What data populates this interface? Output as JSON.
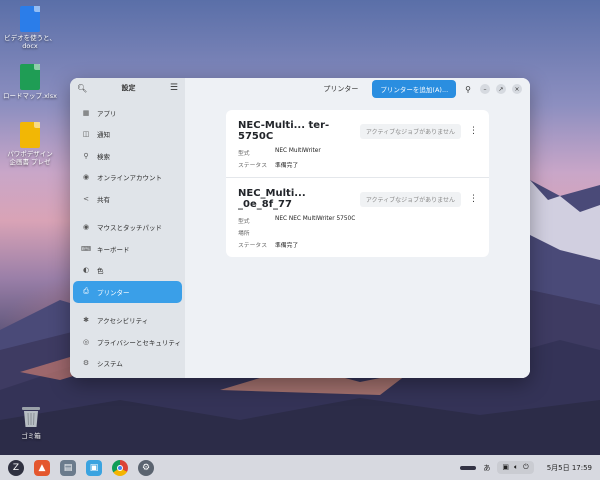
{
  "desktop": {
    "icons": [
      {
        "label": "ビデオを使うと、\ndocx",
        "color": "#2b7de9"
      },
      {
        "label": "ロードマップ.xlsx",
        "color": "#1f9d55"
      },
      {
        "label": "パワポデザイン\n企画書 プレゼ",
        "color": "#f2b705"
      }
    ],
    "trash_label": "ゴミ箱"
  },
  "window": {
    "sidebar_title": "設定",
    "header_title": "プリンター",
    "add_button": "プリンターを追加(A)...",
    "sidebar": {
      "items": [
        {
          "label": "アプリ",
          "icon": "apps-icon"
        },
        {
          "label": "通知",
          "icon": "bell-icon"
        },
        {
          "label": "検索",
          "icon": "search-icon"
        },
        {
          "label": "オンラインアカウント",
          "icon": "account-icon"
        },
        {
          "label": "共有",
          "icon": "share-icon"
        },
        {
          "label": "マウスとタッチパッド",
          "icon": "mouse-icon"
        },
        {
          "label": "キーボード",
          "icon": "keyboard-icon"
        },
        {
          "label": "色",
          "icon": "color-icon"
        },
        {
          "label": "プリンター",
          "icon": "printer-icon"
        },
        {
          "label": "アクセシビリティ",
          "icon": "accessibility-icon"
        },
        {
          "label": "プライバシーとセキュリティ",
          "icon": "privacy-icon"
        },
        {
          "label": "システム",
          "icon": "gear-icon"
        }
      ]
    },
    "printers": [
      {
        "name": "NEC-Multi... ter-5750C",
        "jobs": "アクティブなジョブがありません",
        "rows": [
          {
            "k": "型式",
            "v": "NEC MultiWriter"
          },
          {
            "k": "ステータス",
            "v": "準備完了"
          }
        ]
      },
      {
        "name": "NEC_Multi... _0e_8f_77",
        "jobs": "アクティブなジョブがありません",
        "rows": [
          {
            "k": "型式",
            "v": "NEC NEC MultiWriter 5750C"
          },
          {
            "k": "場所",
            "v": ""
          },
          {
            "k": "ステータス",
            "v": "準備完了"
          }
        ]
      }
    ]
  },
  "taskbar": {
    "input_method": "あ",
    "clock": "5月5日 17:59"
  }
}
